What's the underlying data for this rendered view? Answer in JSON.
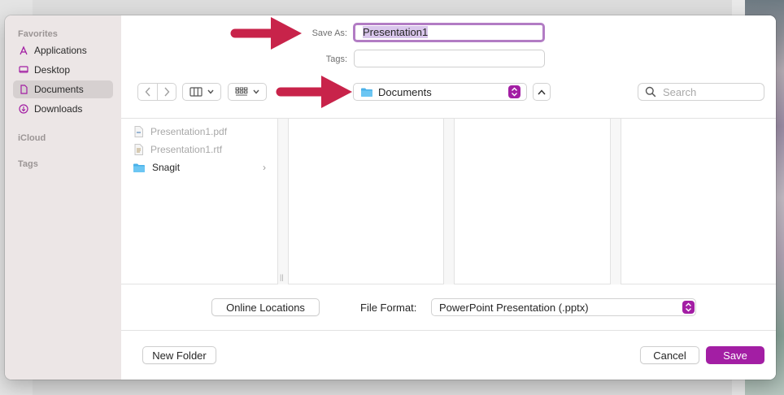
{
  "sidebar": {
    "favorites_heading": "Favorites",
    "items": [
      {
        "label": "Applications",
        "icon": "applications-icon"
      },
      {
        "label": "Desktop",
        "icon": "desktop-icon"
      },
      {
        "label": "Documents",
        "icon": "documents-icon",
        "selected": true
      },
      {
        "label": "Downloads",
        "icon": "downloads-icon"
      }
    ],
    "icloud_heading": "iCloud",
    "tags_heading": "Tags"
  },
  "save_as": {
    "label": "Save As:",
    "value": "Presentation1"
  },
  "tags": {
    "label": "Tags:",
    "value": ""
  },
  "toolbar": {
    "location": "Documents",
    "search_placeholder": "Search"
  },
  "files": [
    {
      "name": "Presentation1.pdf",
      "dimmed": true,
      "type": "pdf"
    },
    {
      "name": "Presentation1.rtf",
      "dimmed": true,
      "type": "rtf"
    },
    {
      "name": "Snagit",
      "dimmed": false,
      "type": "folder"
    }
  ],
  "options": {
    "online_locations": "Online Locations",
    "file_format_label": "File Format:",
    "file_format_value": "PowerPoint Presentation (.pptx)"
  },
  "footer": {
    "new_folder": "New Folder",
    "cancel": "Cancel",
    "save": "Save"
  },
  "colors": {
    "accent": "#a31ea4",
    "annotation_arrow": "#c8234a",
    "focus_ring": "#b27cc4"
  }
}
